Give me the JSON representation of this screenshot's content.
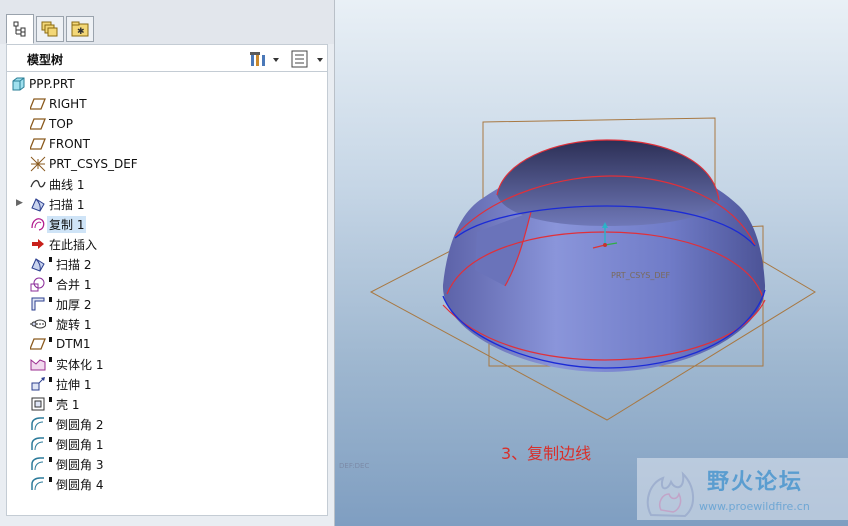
{
  "model_tree": {
    "title": "模型树",
    "tabs": [
      "model-tree-tab",
      "layers-tab",
      "favorites-tab"
    ],
    "items": [
      {
        "label": "PPP.PRT",
        "icon": "part-icon"
      },
      {
        "label": "RIGHT",
        "icon": "datum-plane-icon"
      },
      {
        "label": "TOP",
        "icon": "datum-plane-icon"
      },
      {
        "label": "FRONT",
        "icon": "datum-plane-icon"
      },
      {
        "label": "PRT_CSYS_DEF",
        "icon": "csys-icon"
      },
      {
        "label": "曲线 1",
        "icon": "curve-icon"
      },
      {
        "label": "扫描 1",
        "icon": "sweep-icon"
      },
      {
        "label": "复制 1",
        "icon": "copy-icon",
        "selected": true
      },
      {
        "label": "在此插入",
        "icon": "insert-here-icon"
      },
      {
        "label": "扫描 2",
        "icon": "sweep-icon"
      },
      {
        "label": "合并 1",
        "icon": "merge-icon"
      },
      {
        "label": "加厚 2",
        "icon": "thicken-icon"
      },
      {
        "label": "旋转 1",
        "icon": "revolve-icon"
      },
      {
        "label": "DTM1",
        "icon": "datum-plane-icon"
      },
      {
        "label": "实体化 1",
        "icon": "solidify-icon"
      },
      {
        "label": "拉伸 1",
        "icon": "extrude-icon"
      },
      {
        "label": "壳 1",
        "icon": "shell-icon"
      },
      {
        "label": "倒圆角 2",
        "icon": "round-icon"
      },
      {
        "label": "倒圆角 1",
        "icon": "round-icon"
      },
      {
        "label": "倒圆角 3",
        "icon": "round-icon"
      },
      {
        "label": "倒圆角 4",
        "icon": "round-icon"
      }
    ]
  },
  "viewport": {
    "csys_label": "PRT_CSYS_DEF",
    "caption": "3、复制边线",
    "dim_text": "DEF:DEC"
  },
  "watermark": {
    "name": "野火论坛",
    "url": "www.proewildfire.cn"
  },
  "colors": {
    "caption": "#d8302b",
    "surface": "#7b86cc",
    "edge_red": "#e0303a",
    "edge_blue": "#1b2bd6",
    "datum_plane": "#a87842"
  }
}
